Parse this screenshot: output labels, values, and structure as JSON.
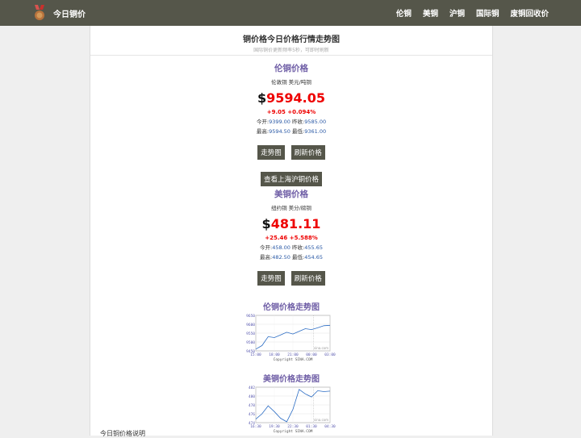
{
  "topbar": {
    "site_title": "今日铜价",
    "nav": [
      "伦铜",
      "美铜",
      "沪铜",
      "国际铜",
      "废铜回收价"
    ]
  },
  "header": {
    "title": "铜价格今日价格行情走势图",
    "subtitle": "国际铜价更新频率5秒，可即时刷新"
  },
  "lme": {
    "title": "伦铜价格",
    "desc": "伦敦铜 美元/吨铜",
    "currency": "$",
    "price": "9594.05",
    "change": "+9.05 +0.094%",
    "open_label": "今开:",
    "open": "9399.00",
    "prev_label": "昨收:",
    "prev": "9585.00",
    "high_label": "最高:",
    "high": "9594.50",
    "low_label": "最低:",
    "low": "9361.00",
    "chart_btn": "走势图",
    "refresh_btn": "刷新价格"
  },
  "shanghai_btn": "查看上海沪铜价格",
  "comex": {
    "title": "美铜价格",
    "desc": "纽约铜 美分/磅铜",
    "currency": "$",
    "price": "481.11",
    "change": "+25.46 +5.588%",
    "open_label": "今开:",
    "open": "458.00",
    "prev_label": "昨收:",
    "prev": "455.65",
    "high_label": "最高:",
    "high": "482.50",
    "low_label": "最低:",
    "low": "454.65",
    "chart_btn": "走势图",
    "refresh_btn": "刷新价格"
  },
  "chart1": {
    "title": "伦铜价格走势图",
    "yticks": [
      "9650",
      "9600",
      "9550",
      "9500",
      "9450"
    ],
    "xticks": [
      "15:00",
      "18:00",
      "21:00",
      "00:00",
      "03:00"
    ],
    "copyright": "Copyright SINA.COM",
    "watermark": "sina.com",
    "chart_data": {
      "type": "line",
      "x": [
        "15:00",
        "18:00",
        "21:00",
        "00:00",
        "03:00"
      ],
      "series": [
        {
          "values": [
            9460,
            9480,
            9530,
            9525,
            9540,
            9555,
            9545,
            9560,
            9575,
            9570,
            9580,
            9592,
            9594
          ]
        }
      ],
      "ylim": [
        9450,
        9650
      ]
    }
  },
  "chart2": {
    "title": "美铜价格走势图",
    "yticks": [
      "482",
      "480",
      "478",
      "476",
      "474"
    ],
    "xticks": [
      "16:30",
      "19:30",
      "22:30",
      "01:30",
      "04:30"
    ],
    "copyright": "Copyright SINA.COM",
    "watermark": "sina.com",
    "chart_data": {
      "type": "line",
      "x": [
        "16:30",
        "19:30",
        "22:30",
        "01:30",
        "04:30"
      ],
      "series": [
        {
          "values": [
            474.8,
            476.0,
            477.8,
            476.5,
            475.0,
            474.2,
            477.0,
            481.5,
            480.5,
            479.8,
            481.2,
            481.0,
            481.1
          ]
        }
      ],
      "ylim": [
        474,
        482
      ]
    }
  },
  "footer_text": "今日铜价格说明"
}
